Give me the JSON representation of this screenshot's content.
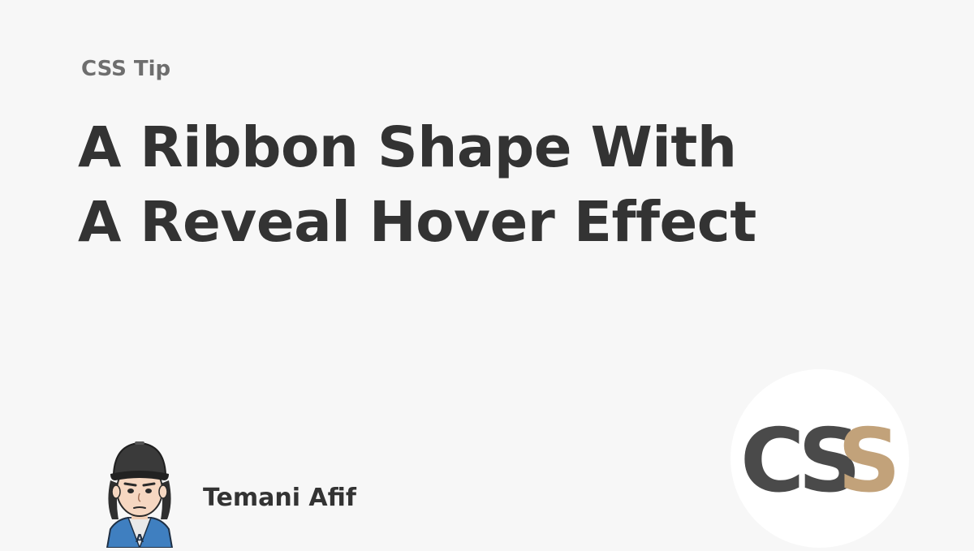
{
  "kicker": "CSS Tip",
  "title": {
    "line1": "A Ribbon Shape With",
    "line2": "A Reveal Hover Effect"
  },
  "author": {
    "name": "Temani Afif",
    "avatar_icon": "cartoon-avatar-icon"
  },
  "logo": {
    "text": "CSS",
    "icon": "css-logo-icon",
    "colors": {
      "dark": "#4a4a4a",
      "accent": "#c2a27a"
    }
  },
  "colors": {
    "background": "#f7f7f7",
    "title": "#333333",
    "kicker": "#6e6e6e"
  }
}
